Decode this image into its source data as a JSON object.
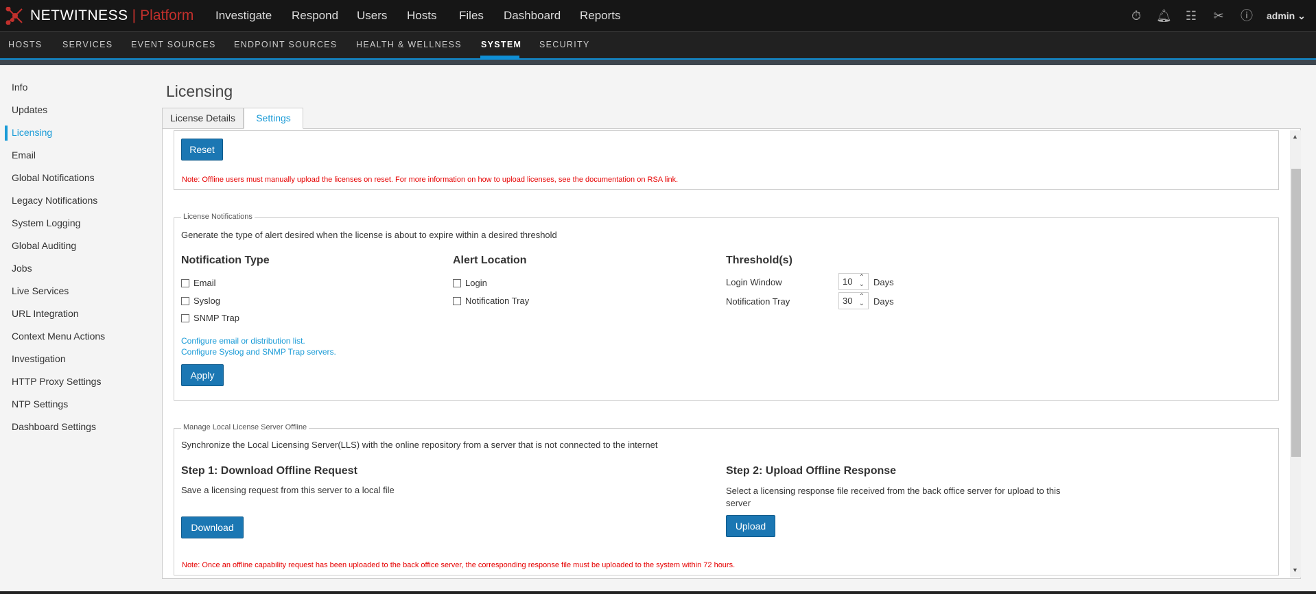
{
  "brand": {
    "name": "NETWITNESS",
    "product": "Platform"
  },
  "topnav": [
    "Investigate",
    "Respond",
    "Users",
    "Hosts",
    "Files",
    "Dashboard",
    "Reports"
  ],
  "user": "admin",
  "icons": [
    "stopwatch-icon",
    "bell-icon",
    "settings-panel-icon",
    "tools-icon",
    "help-icon",
    "chevron-down-icon"
  ],
  "subnav": [
    "HOSTS",
    "SERVICES",
    "EVENT SOURCES",
    "ENDPOINT SOURCES",
    "HEALTH & WELLNESS",
    "SYSTEM",
    "SECURITY"
  ],
  "sidebar": [
    "Info",
    "Updates",
    "Licensing",
    "Email",
    "Global Notifications",
    "Legacy Notifications",
    "System Logging",
    "Global Auditing",
    "Jobs",
    "Live Services",
    "URL Integration",
    "Context Menu Actions",
    "Investigation",
    "HTTP Proxy Settings",
    "NTP Settings",
    "Dashboard Settings"
  ],
  "page_title": "Licensing",
  "tabs": [
    "License Details",
    "Settings"
  ],
  "reset": {
    "button": "Reset",
    "note": "Note: Offline users must manually upload the licenses on reset. For more information on how to upload licenses, see the documentation on RSA link."
  },
  "notifications": {
    "legend": "License Notifications",
    "description": "Generate the type of alert desired when the license is about to expire within a desired threshold",
    "type_heading": "Notification Type",
    "types": [
      "Email",
      "Syslog",
      "SNMP Trap"
    ],
    "location_heading": "Alert Location",
    "locations": [
      "Login",
      "Notification Tray"
    ],
    "threshold_heading": "Threshold(s)",
    "thresholds": [
      {
        "label": "Login Window",
        "value": "10",
        "unit": "Days"
      },
      {
        "label": "Notification Tray",
        "value": "30",
        "unit": "Days"
      }
    ],
    "links": [
      "Configure email or distribution list.",
      "Configure Syslog and SNMP Trap servers."
    ],
    "apply": "Apply"
  },
  "offline": {
    "legend": "Manage Local License Server Offline",
    "description": "Synchronize the Local Licensing Server(LLS) with the online repository from a server that is not connected to the internet",
    "step1_heading": "Step 1: Download Offline Request",
    "step1_desc": "Save a licensing request from this server to a local file",
    "download": "Download",
    "step2_heading": "Step 2: Upload Offline Response",
    "step2_desc": "Select a licensing response file received from the back office server for upload to this server",
    "upload": "Upload",
    "note": "Note: Once an offline capability request has been uploaded to the back office server, the corresponding response file must be uploaded to the system within 72 hours."
  }
}
